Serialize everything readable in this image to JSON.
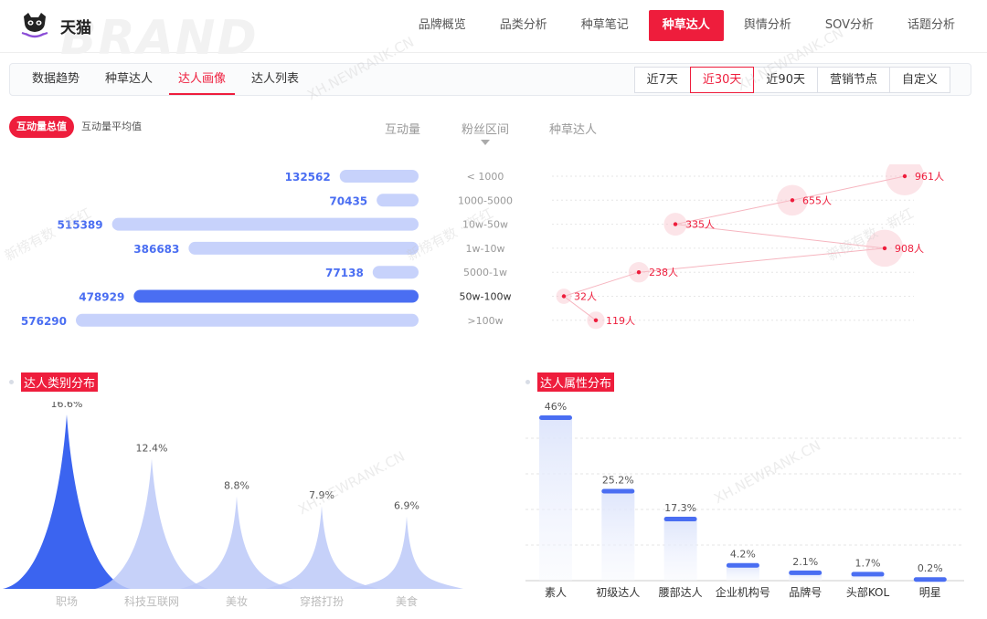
{
  "brand": {
    "name": "天猫",
    "watermark": "BRAND"
  },
  "topnav": [
    {
      "label": "品牌概览",
      "active": false
    },
    {
      "label": "品类分析",
      "active": false
    },
    {
      "label": "种草笔记",
      "active": false
    },
    {
      "label": "种草达人",
      "active": true
    },
    {
      "label": "舆情分析",
      "active": false
    },
    {
      "label": "SOV分析",
      "active": false
    },
    {
      "label": "话题分析",
      "active": false
    }
  ],
  "subtabs": [
    {
      "label": "数据趋势",
      "active": false
    },
    {
      "label": "种草达人",
      "active": false
    },
    {
      "label": "达人画像",
      "active": true
    },
    {
      "label": "达人列表",
      "active": false
    }
  ],
  "date_buttons": [
    {
      "label": "近7天",
      "active": false
    },
    {
      "label": "近30天",
      "active": true
    },
    {
      "label": "近90天",
      "active": false
    },
    {
      "label": "营销节点",
      "active": false
    },
    {
      "label": "自定义",
      "active": false
    }
  ],
  "interaction_toggle": [
    {
      "label": "互动量总值",
      "active": true
    },
    {
      "label": "互动量平均值",
      "active": false
    }
  ],
  "column_headers": {
    "interaction": "互动量",
    "fan_range": "粉丝区间",
    "influencers": "种草达人"
  },
  "watermarks": [
    "XH.NEWRANK.CN",
    "新榜有数 · 新红"
  ],
  "colors": {
    "accent": "#ee1d3c",
    "bar_light": "#c7d2fb",
    "bar_strong": "#4a6ef2",
    "area_strong": "#3b64f0",
    "area_light": "#bcc9f8",
    "bubble": "#f8c4cc"
  },
  "chart_data": [
    {
      "type": "bar",
      "orientation": "horizontal",
      "categories": [
        "< 1000",
        "1000-5000",
        "10w-50w",
        "1w-10w",
        "5000-1w",
        "50w-100w",
        ">100w"
      ],
      "values": [
        132562,
        70435,
        515389,
        386683,
        77138,
        478929,
        576290
      ],
      "highlight": "50w-100w"
    },
    {
      "type": "scatter",
      "categories": [
        "< 1000",
        "1000-5000",
        "10w-50w",
        "1w-10w",
        "5000-1w",
        "50w-100w",
        ">100w"
      ],
      "values": [
        961,
        655,
        335,
        908,
        238,
        32,
        119
      ],
      "labels": [
        "961人",
        "655人",
        "335人",
        "908人",
        "238人",
        "32人",
        "119人"
      ]
    },
    {
      "type": "area",
      "title": "达人类别分布",
      "categories": [
        "职场",
        "科技互联网",
        "美妆",
        "穿搭打扮",
        "美食"
      ],
      "values": [
        16.6,
        12.4,
        8.8,
        7.9,
        6.9
      ],
      "labels": [
        "16.6%",
        "12.4%",
        "8.8%",
        "7.9%",
        "6.9%"
      ],
      "ylim": [
        0,
        18
      ]
    },
    {
      "type": "bar",
      "title": "达人属性分布",
      "categories": [
        "素人",
        "初级达人",
        "腰部达人",
        "企业机构号",
        "品牌号",
        "头部KOL",
        "明星"
      ],
      "values": [
        46,
        25.2,
        17.3,
        4.2,
        2.1,
        1.7,
        0.2
      ],
      "labels": [
        "46%",
        "25.2%",
        "17.3%",
        "4.2%",
        "2.1%",
        "1.7%",
        "0.2%"
      ],
      "ylim": [
        0,
        50
      ]
    }
  ]
}
